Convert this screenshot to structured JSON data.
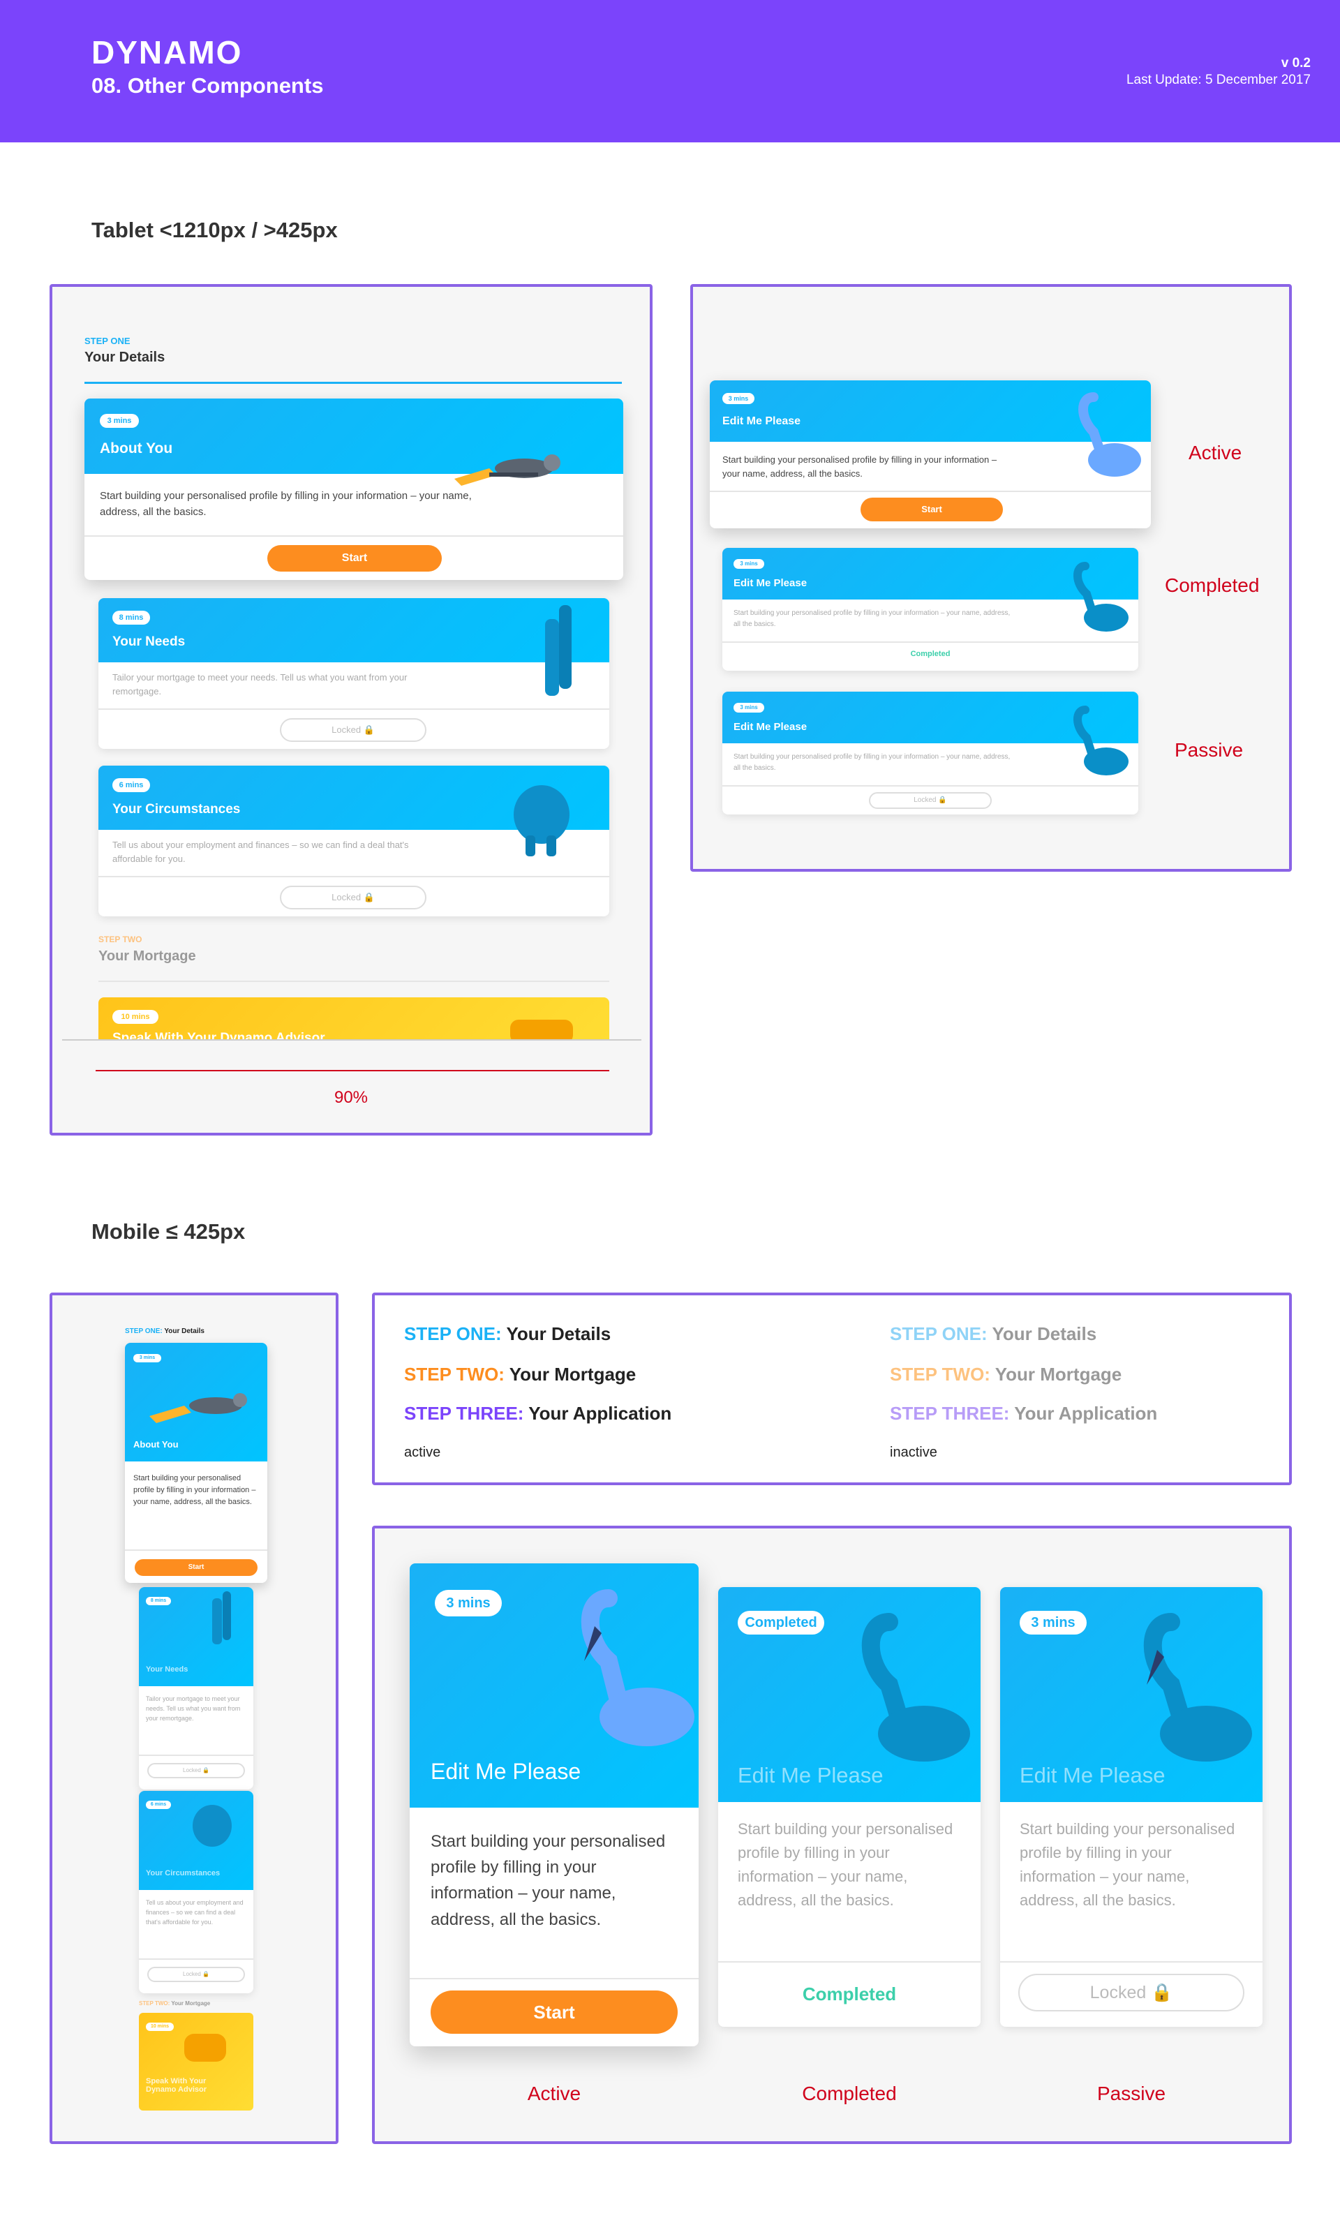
{
  "header": {
    "brand": "DYNAMO",
    "subtitle": "08. Other Components",
    "version": "v 0.2",
    "last_update": "Last Update: 5 December 2017",
    "bg_color": "#7b44fb"
  },
  "tablet": {
    "section_title": "Tablet <1210px / >425px",
    "steps": {
      "one_tag": "STEP ONE",
      "one_title": "Your Details",
      "two_tag": "STEP TWO",
      "two_title": "Your Mortgage"
    },
    "cards": [
      {
        "mins": "3 mins",
        "title": "About You",
        "desc": "Start building your personalised profile by filling in your information – your name, address, all the basics.",
        "button": "Start",
        "icon": "keys-icon"
      },
      {
        "mins": "8 mins",
        "title": "Your Needs",
        "desc": "Tailor your mortgage to meet your needs. Tell us what you want from your remortgage.",
        "button": "Locked",
        "icon": "pepper-mill-icon"
      },
      {
        "mins": "6 mins",
        "title": "Your Circumstances",
        "desc": "Tell us about your employment and finances – so we can find a deal that's affordable for you.",
        "button": "Locked",
        "icon": "piggy-bank-icon"
      },
      {
        "mins": "10 mins",
        "title": "Speak With Your Dynamo Advisor",
        "icon": "phone-icon"
      }
    ],
    "percent": "90%",
    "variants": [
      {
        "mins": "3 mins",
        "title": "Edit Me Please",
        "desc": "Start building your personalised profile by filling in your information – your name, address, all the basics.",
        "action": "Start",
        "state": "Active"
      },
      {
        "mins": "3 mins",
        "title": "Edit Me Please",
        "desc": "Start building your personalised profile by filling in your information – your name, address, all the basics.",
        "action": "Completed",
        "state": "Completed"
      },
      {
        "mins": "3 mins",
        "title": "Edit Me Please",
        "desc": "Start building your personalised profile by filling in your information – your name, address, all the basics.",
        "action": "Locked",
        "state": "Passive"
      }
    ]
  },
  "mobile": {
    "section_title": "Mobile ≤ 425px",
    "step_tag": "STEP ONE:",
    "step_title": "Your Details",
    "step_two_tag": "STEP TWO:",
    "step_two_title": "Your Mortgage",
    "cards": [
      {
        "mins": "3 mins",
        "title": "About You",
        "desc": "Start building your personalised profile by filling in your information – your name, address, all the basics.",
        "button": "Start"
      },
      {
        "mins": "8 mins",
        "title": "Your Needs",
        "desc": "Tailor your mortgage to meet your needs. Tell us what you want from your remortgage.",
        "button": "Locked"
      },
      {
        "mins": "6 mins",
        "title": "Your Circumstances",
        "desc": "Tell us about your employment and finances – so we can find a deal that's affordable for you.",
        "button": "Locked"
      },
      {
        "mins": "10 mins",
        "title": "Speak With Your Dynamo Advisor"
      }
    ],
    "steps_active": [
      {
        "tag": "STEP ONE:",
        "title": "Your Details",
        "color": "#1ab1f6"
      },
      {
        "tag": "STEP TWO:",
        "title": "Your Mortgage",
        "color": "#fd8d1f"
      },
      {
        "tag": "STEP THREE:",
        "title": "Your Application",
        "color": "#7b44fb"
      }
    ],
    "steps_inactive": [
      {
        "tag": "STEP ONE:",
        "title": "Your Details",
        "color": "#8fd3f7"
      },
      {
        "tag": "STEP TWO:",
        "title": "Your Mortgage",
        "color": "#fdc27f"
      },
      {
        "tag": "STEP THREE:",
        "title": "Your Application",
        "color": "#b79cf7"
      }
    ],
    "active_label": "active",
    "inactive_label": "inactive",
    "variants": [
      {
        "badge": "3 mins",
        "title": "Edit Me Please",
        "desc": "Start building your personalised profile by filling in your information – your name, address, all the basics.",
        "action": "Start",
        "state": "Active"
      },
      {
        "badge": "Completed",
        "title": "Edit Me Please",
        "desc": "Start building your personalised profile by filling in your information – your name, address, all the basics.",
        "action": "Completed",
        "state": "Completed"
      },
      {
        "badge": "3 mins",
        "title": "Edit Me Please",
        "desc": "Start building your personalised profile by filling in your information – your name, address, all the basics.",
        "action": "Locked",
        "state": "Passive"
      }
    ]
  }
}
